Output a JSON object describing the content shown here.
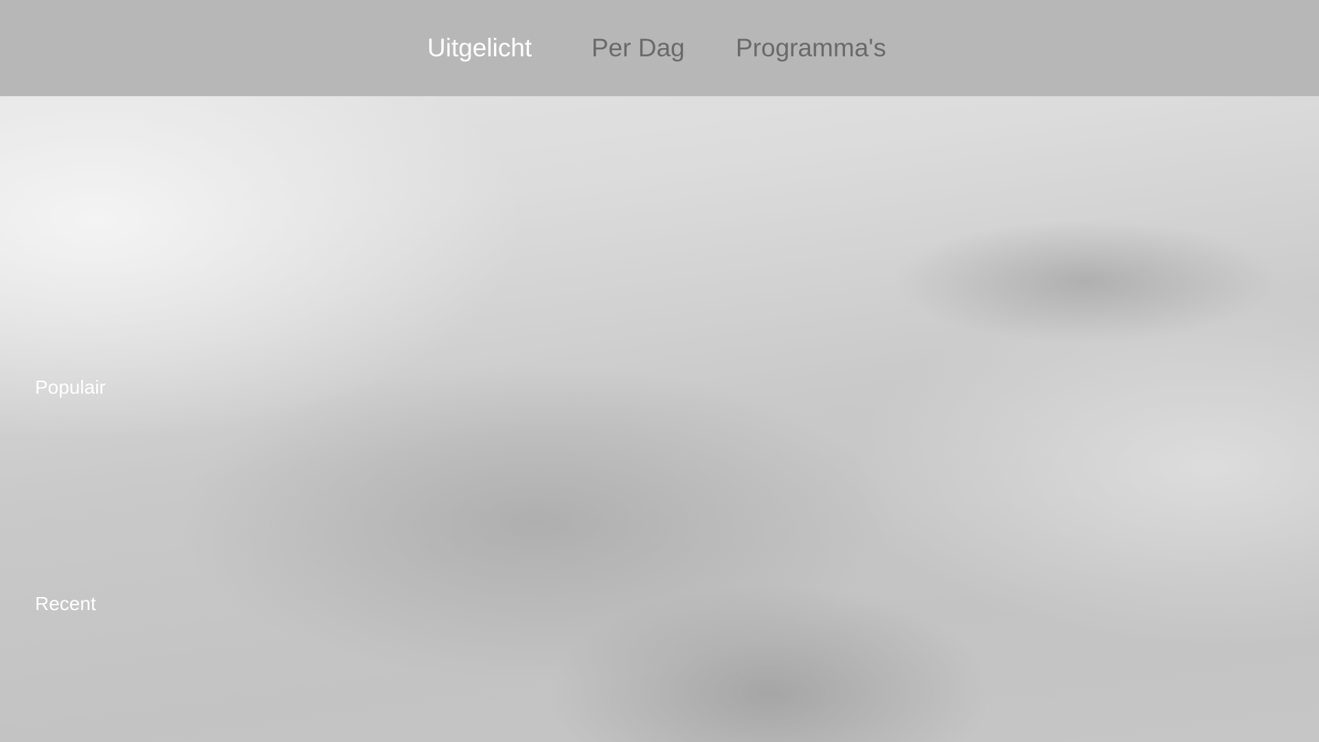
{
  "nav": {
    "tabs": [
      {
        "label": "Uitgelicht",
        "selected": true
      },
      {
        "label": "Per Dag",
        "selected": false
      },
      {
        "label": "Programma's",
        "selected": false
      }
    ]
  },
  "sections": {
    "popular": {
      "title": "Populair"
    },
    "recent": {
      "title": "Recent"
    }
  },
  "colors": {
    "top_bar": "#b7b7b7",
    "tab_selected": "#ffffff",
    "tab_unselected": "#6a6a6a",
    "section_label": "#ffffff"
  }
}
